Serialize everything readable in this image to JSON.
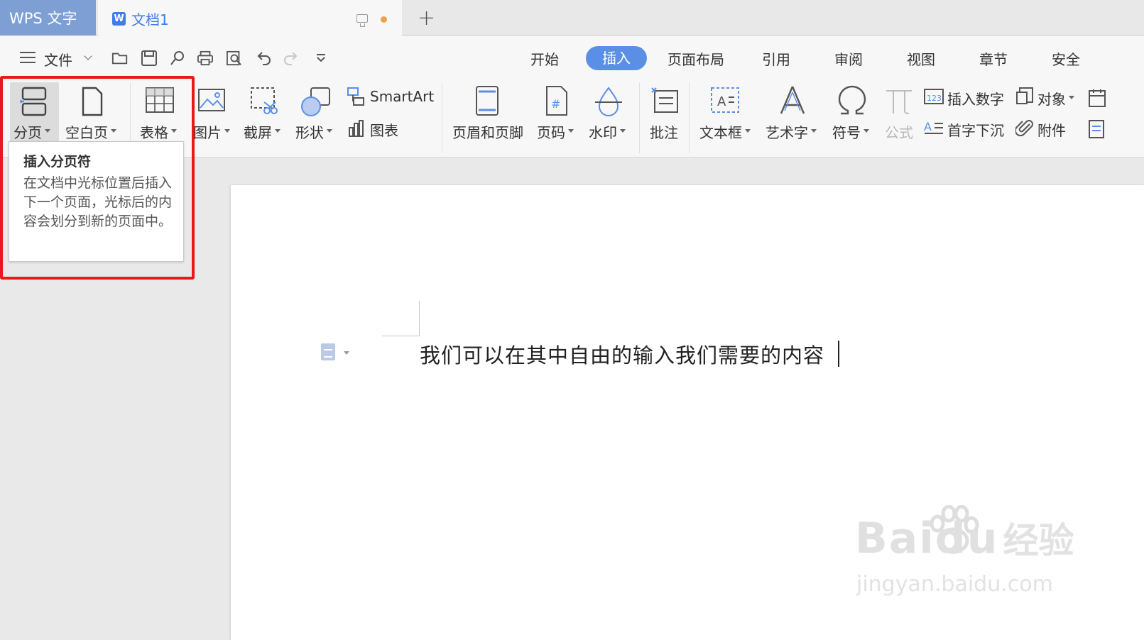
{
  "tabbar": {
    "app_title": "WPS 文字",
    "doc_tab_title": "文档1",
    "doc_icon_letter": "W",
    "new_tab_label": "+",
    "unsaved_dot_color": "#f0a045"
  },
  "menu": {
    "file_label": "文件",
    "tabs": [
      "开始",
      "插入",
      "页面布局",
      "引用",
      "审阅",
      "视图",
      "章节",
      "安全"
    ],
    "active_tab": "插入",
    "accent_color": "#5b8fe6"
  },
  "quick_access": {
    "icons": [
      "open-folder-icon",
      "save-icon",
      "export-pdf-icon",
      "print-icon",
      "print-preview-icon",
      "undo-icon",
      "redo-icon",
      "customize-dropdown-icon"
    ]
  },
  "ribbon": {
    "page_break": "分页",
    "blank_page": "空白页",
    "table": "表格",
    "picture": "图片",
    "screenshot": "截屏",
    "shapes": "形状",
    "smartart": "SmartArt",
    "chart": "图表",
    "header_footer": "页眉和页脚",
    "page_number": "页码",
    "watermark": "水印",
    "comment": "批注",
    "textbox": "文本框",
    "wordart": "艺术字",
    "symbol": "符号",
    "formula": "公式",
    "insert_number": "插入数字",
    "object": "对象",
    "drop_cap": "首字下沉",
    "attachment": "附件"
  },
  "tooltip": {
    "title": "插入分页符",
    "body": "在文档中光标位置后插入下一个页面，光标后的内容会划分到新的页面中。"
  },
  "document": {
    "text": "我们可以在其中自由的输入我们需要的内容"
  },
  "watermark_logo": {
    "brand": "Baidu",
    "cn": "经验",
    "url": "jingyan.baidu.com"
  },
  "highlight_color": "#e8181d"
}
